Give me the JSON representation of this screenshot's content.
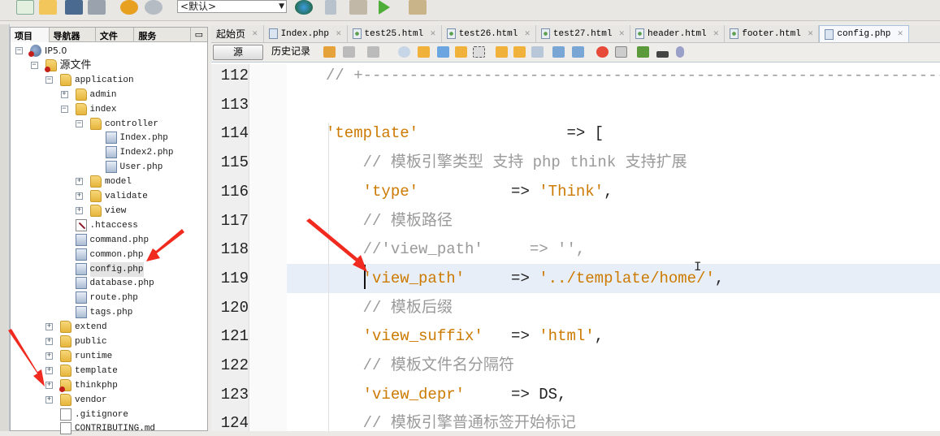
{
  "toolbar": {
    "config_select": "<默认>"
  },
  "left_panel": {
    "tabs": [
      "项目",
      "导航器",
      "文件",
      "服务"
    ],
    "tree": [
      {
        "label": "IP5.0",
        "depth": 0,
        "icon": "php-project-icon",
        "expander": "-",
        "badge": true
      },
      {
        "label": "源文件",
        "depth": 1,
        "icon": "source-package-icon",
        "expander": "-",
        "badge": true
      },
      {
        "label": "application",
        "depth": 2,
        "icon": "folder-icon",
        "expander": "-"
      },
      {
        "label": "admin",
        "depth": 3,
        "icon": "folder-icon",
        "expander": "+"
      },
      {
        "label": "index",
        "depth": 3,
        "icon": "folder-icon",
        "expander": "-"
      },
      {
        "label": "controller",
        "depth": 4,
        "icon": "folder-icon",
        "expander": "-"
      },
      {
        "label": "Index.php",
        "depth": 5,
        "icon": "php-file-icon"
      },
      {
        "label": "Index2.php",
        "depth": 5,
        "icon": "php-file-icon"
      },
      {
        "label": "User.php",
        "depth": 5,
        "icon": "php-file-icon"
      },
      {
        "label": "model",
        "depth": 4,
        "icon": "folder-icon",
        "expander": "+"
      },
      {
        "label": "validate",
        "depth": 4,
        "icon": "folder-icon",
        "expander": "+"
      },
      {
        "label": "view",
        "depth": 4,
        "icon": "folder-icon",
        "expander": "+"
      },
      {
        "label": ".htaccess",
        "depth": 3,
        "icon": "htaccess-file-icon"
      },
      {
        "label": "command.php",
        "depth": 3,
        "icon": "php-file-icon"
      },
      {
        "label": "common.php",
        "depth": 3,
        "icon": "php-file-icon"
      },
      {
        "label": "config.php",
        "depth": 3,
        "icon": "php-file-icon",
        "selected": true
      },
      {
        "label": "database.php",
        "depth": 3,
        "icon": "php-file-icon"
      },
      {
        "label": "route.php",
        "depth": 3,
        "icon": "php-file-icon"
      },
      {
        "label": "tags.php",
        "depth": 3,
        "icon": "php-file-icon"
      },
      {
        "label": "extend",
        "depth": 2,
        "icon": "folder-icon",
        "expander": "+"
      },
      {
        "label": "public",
        "depth": 2,
        "icon": "folder-icon",
        "expander": "+"
      },
      {
        "label": "runtime",
        "depth": 2,
        "icon": "folder-icon",
        "expander": "+"
      },
      {
        "label": "template",
        "depth": 2,
        "icon": "folder-icon",
        "expander": "+"
      },
      {
        "label": "thinkphp",
        "depth": 2,
        "icon": "folder-icon",
        "expander": "+",
        "badge": true
      },
      {
        "label": "vendor",
        "depth": 2,
        "icon": "folder-icon",
        "expander": "+"
      },
      {
        "label": ".gitignore",
        "depth": 2,
        "icon": "plain-file-icon"
      },
      {
        "label": "CONTRIBUTING.md",
        "depth": 2,
        "icon": "plain-file-icon"
      }
    ]
  },
  "editor": {
    "tabs": [
      {
        "label": "起始页",
        "icon": "none"
      },
      {
        "label": "Index.php",
        "icon": "php-file-icon"
      },
      {
        "label": "test25.html",
        "icon": "html-file-icon"
      },
      {
        "label": "test26.html",
        "icon": "html-file-icon"
      },
      {
        "label": "test27.html",
        "icon": "html-file-icon"
      },
      {
        "label": "header.html",
        "icon": "html-file-icon"
      },
      {
        "label": "footer.html",
        "icon": "html-file-icon"
      },
      {
        "label": "config.php",
        "icon": "php-file-icon",
        "active": true
      }
    ],
    "source_label": "源",
    "history_label": "历史记录",
    "lines": [
      {
        "n": "112",
        "parts": [
          [
            "c",
            "// +-----------------------------------------------------------------------"
          ]
        ]
      },
      {
        "n": "113",
        "parts": []
      },
      {
        "n": "114",
        "parts": [
          [
            "s",
            "'template'"
          ],
          [
            "p",
            "                => ["
          ]
        ]
      },
      {
        "n": "115",
        "parts": [
          [
            "p",
            "    "
          ],
          [
            "c",
            "// 模板引擎类型 支持 php think 支持扩展"
          ]
        ]
      },
      {
        "n": "116",
        "parts": [
          [
            "p",
            "    "
          ],
          [
            "s",
            "'type'"
          ],
          [
            "p",
            "          => "
          ],
          [
            "s",
            "'Think'"
          ],
          [
            "p",
            ","
          ]
        ]
      },
      {
        "n": "117",
        "parts": [
          [
            "p",
            "    "
          ],
          [
            "c",
            "// 模板路径"
          ]
        ]
      },
      {
        "n": "118",
        "parts": [
          [
            "p",
            "    "
          ],
          [
            "c",
            "//'view_path'     => '',"
          ]
        ]
      },
      {
        "n": "119",
        "parts": [
          [
            "p",
            "    "
          ],
          [
            "s",
            "'view_path'"
          ],
          [
            "p",
            "     => "
          ],
          [
            "s",
            "'../template/home/'"
          ],
          [
            "p",
            ","
          ]
        ],
        "current": true
      },
      {
        "n": "120",
        "parts": [
          [
            "p",
            "    "
          ],
          [
            "c",
            "// 模板后缀"
          ]
        ]
      },
      {
        "n": "121",
        "parts": [
          [
            "p",
            "    "
          ],
          [
            "s",
            "'view_suffix'"
          ],
          [
            "p",
            "   => "
          ],
          [
            "s",
            "'html'"
          ],
          [
            "p",
            ","
          ]
        ]
      },
      {
        "n": "122",
        "parts": [
          [
            "p",
            "    "
          ],
          [
            "c",
            "// 模板文件名分隔符"
          ]
        ]
      },
      {
        "n": "123",
        "parts": [
          [
            "p",
            "    "
          ],
          [
            "s",
            "'view_depr'"
          ],
          [
            "p",
            "     => DS,"
          ]
        ]
      },
      {
        "n": "124",
        "parts": [
          [
            "p",
            "    "
          ],
          [
            "c",
            "// 模板引擎普通标签开始标记"
          ]
        ]
      }
    ]
  },
  "colors": {
    "string": "#cc7a00",
    "comment": "#9a9a9a",
    "current_line": "#e8eef7",
    "annotation_arrow": "#f02a1e"
  }
}
